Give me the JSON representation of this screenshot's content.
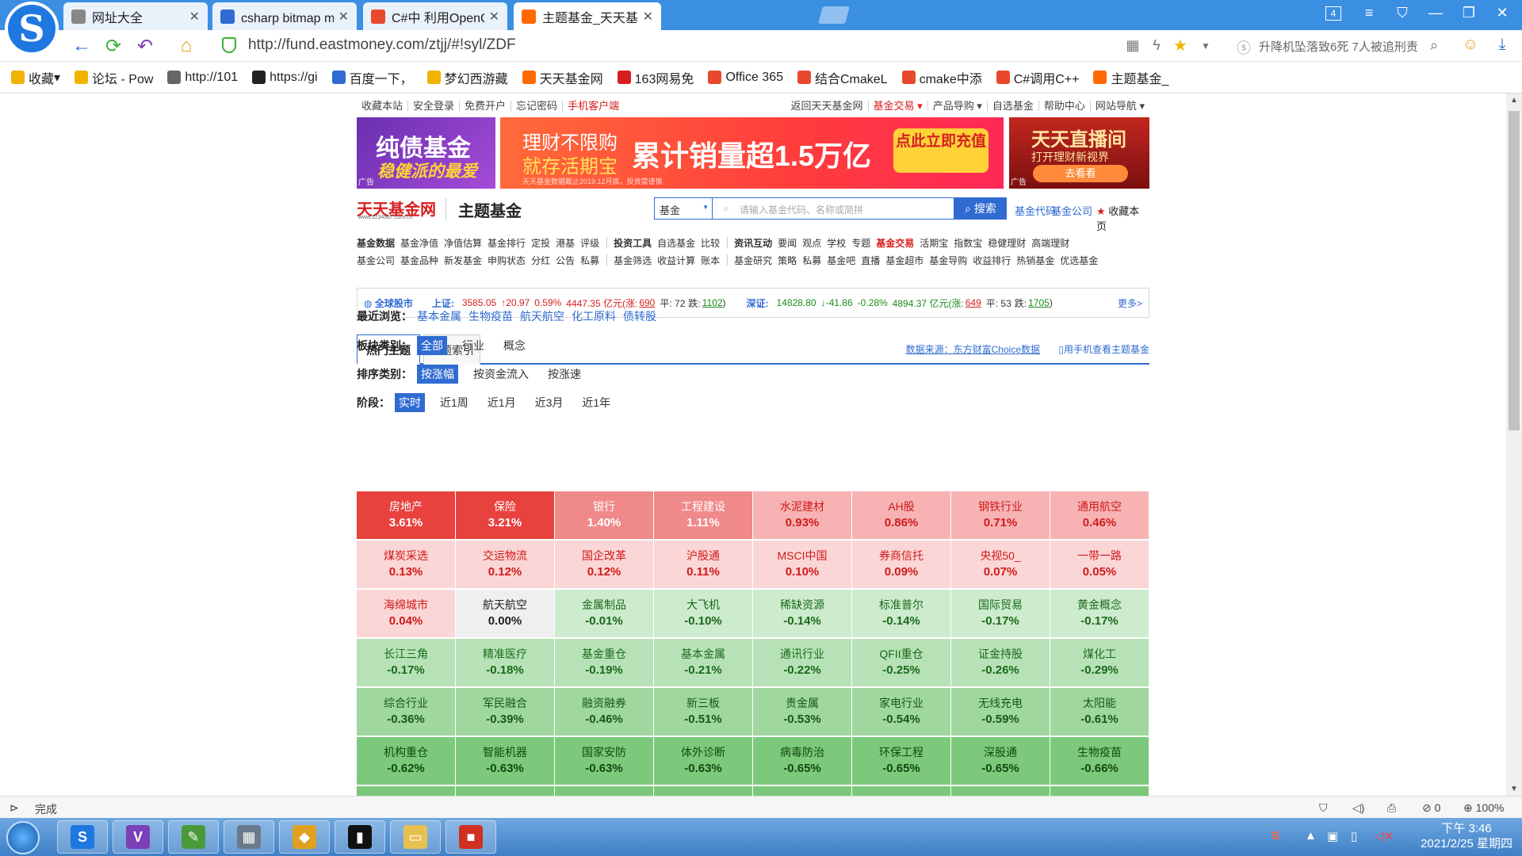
{
  "browser": {
    "tabs": [
      {
        "title": "网址大全",
        "icon_color": "#888888"
      },
      {
        "title": "csharp bitmap mat_百",
        "icon_color": "#2f6bd1"
      },
      {
        "title": "C#中 利用OpenCvShar",
        "icon_color": "#e8492d"
      },
      {
        "title": "主题基金_天天基金网",
        "icon_color": "#ff6a00"
      }
    ],
    "tab_count": "4",
    "url": "http://fund.eastmoney.com/ztjj/#!syl/ZDF",
    "news_ticker": "升降机坠落致6死 7人被追刑责",
    "bookmarks": [
      {
        "label": "收藏",
        "icon": "star-icon",
        "color": "#f0b400"
      },
      {
        "label": "论坛 - Pow",
        "icon": "forum-icon",
        "color": "#f0b400"
      },
      {
        "label": "http://101",
        "icon": "page-icon",
        "color": "#666666"
      },
      {
        "label": "https://gi",
        "icon": "github-icon",
        "color": "#222222"
      },
      {
        "label": "百度一下，",
        "icon": "baidu-icon",
        "color": "#2f6bd1"
      },
      {
        "label": "梦幻西游藏",
        "icon": "game-icon",
        "color": "#f0b400"
      },
      {
        "label": "天天基金网",
        "icon": "fund-icon",
        "color": "#ff6a00"
      },
      {
        "label": "163网易免",
        "icon": "netease-icon",
        "color": "#d71e1e"
      },
      {
        "label": "Office 365",
        "icon": "office-icon",
        "color": "#e8492d"
      },
      {
        "label": "结合CmakeL",
        "icon": "csdn-icon",
        "color": "#e8492d"
      },
      {
        "label": "cmake中添",
        "icon": "csdn-icon",
        "color": "#e8492d"
      },
      {
        "label": "C#调用C++",
        "icon": "csdn-icon",
        "color": "#e8492d"
      },
      {
        "label": "主题基金_",
        "icon": "fund-icon",
        "color": "#ff6a00"
      }
    ],
    "status": "完成",
    "zoom": "100%",
    "blocked_count": "0"
  },
  "site": {
    "topnav_left": [
      "收藏本站",
      "安全登录",
      "免费开户",
      "忘记密码",
      "手机客户端"
    ],
    "topnav_right": [
      "返回天天基金网",
      "基金交易 ▾",
      "产品导购 ▾",
      "自选基金",
      "帮助中心",
      "网站导航 ▾"
    ],
    "banners": {
      "b1_line1": "纯债基金",
      "b1_line2": "稳健派的最爱",
      "b2_line1": "理财不限购",
      "b2_line2": "就存活期宝",
      "b2_headline": "累计销量超1.5万亿",
      "b2_cta": "点此立即充值",
      "b2_small": "天天基金数据截止2019.12月底，投资需谨慎",
      "b3_title": "天天直播间",
      "b3_sub": "打开理财新视界",
      "b3_btn": "去看看",
      "ad_label": "广告"
    },
    "logo": "天天基金网",
    "logo_url": "www.1234567.com.cn",
    "section_title": "主题基金",
    "search": {
      "select": "基金",
      "placeholder": "请输入基金代码、名称或简拼",
      "button": "搜索"
    },
    "logo_links": [
      "基金代码",
      "基金公司"
    ],
    "fav_page": "收藏本页",
    "nav_row1": [
      {
        "t": "基金数据",
        "s": "hd"
      },
      {
        "t": "基金净值"
      },
      {
        "t": "净值估算"
      },
      {
        "t": "基金排行"
      },
      {
        "t": "定投"
      },
      {
        "t": "港基"
      },
      {
        "t": "评级"
      },
      {
        "t": "|",
        "s": "sep"
      },
      {
        "t": "投资工具",
        "s": "hd"
      },
      {
        "t": "自选基金"
      },
      {
        "t": "比较"
      },
      {
        "t": "|",
        "s": "sep"
      },
      {
        "t": "资讯互动",
        "s": "hd"
      },
      {
        "t": "要闻"
      },
      {
        "t": "观点"
      },
      {
        "t": "学校"
      },
      {
        "t": "专题"
      },
      {
        "t": "基金交易",
        "s": "hd-red"
      },
      {
        "t": "活期宝"
      },
      {
        "t": "指数宝"
      },
      {
        "t": "稳健理财"
      },
      {
        "t": "高端理财"
      }
    ],
    "nav_row2": [
      {
        "t": "基金公司"
      },
      {
        "t": "基金品种"
      },
      {
        "t": "新发基金"
      },
      {
        "t": "申购状态"
      },
      {
        "t": "分红"
      },
      {
        "t": "公告"
      },
      {
        "t": "私募"
      },
      {
        "t": "|",
        "s": "sep"
      },
      {
        "t": "基金筛选"
      },
      {
        "t": "收益计算"
      },
      {
        "t": "账本"
      },
      {
        "t": "|",
        "s": "sep"
      },
      {
        "t": "基金研究"
      },
      {
        "t": "策略"
      },
      {
        "t": "私募"
      },
      {
        "t": "基金吧"
      },
      {
        "t": "直播"
      },
      {
        "t": "基金超市"
      },
      {
        "t": "基金导购"
      },
      {
        "t": "收益排行"
      },
      {
        "t": "热销基金"
      },
      {
        "t": "优选基金"
      }
    ],
    "market": {
      "global": "全球股市",
      "sh_label": "上证:",
      "sh_value": "3585.05",
      "sh_change": "↑20.97",
      "sh_pct": "0.59%",
      "sh_amount": "4447.35 亿元(涨:",
      "sh_up": "690",
      "sh_flat": "平: 72",
      "sh_down_label": "跌:",
      "sh_down": "1102",
      "sz_label": "深证:",
      "sz_value": "14828.80",
      "sz_change": "↓-41.86",
      "sz_pct": "-0.28%",
      "sz_amount": "4894.37 亿元(涨:",
      "sz_up": "649",
      "sz_flat": "平: 53",
      "sz_down_label": "跌:",
      "sz_down": "1705",
      "close_paren": ")",
      "more": "更多>"
    },
    "tabs": [
      "热门主题",
      "主题索引"
    ],
    "source": "数据来源：东方财富Choice数据",
    "mobile_view": "用手机查看主题基金",
    "recent_label": "最近浏览：",
    "recent": [
      "基本金属",
      "生物疫苗",
      "航天航空",
      "化工原料",
      "债转股"
    ],
    "sector_label": "板块类别：",
    "sector_opts": [
      "全部",
      "行业",
      "概念"
    ],
    "sort_label": "排序类别：",
    "sort_opts": [
      "按涨幅",
      "按资金流入",
      "按涨速"
    ],
    "period_label": "阶段：",
    "period_opts": [
      "实时",
      "近1周",
      "近1月",
      "近3月",
      "近1年"
    ]
  },
  "heatmap": [
    {
      "name": "房地产",
      "pct": "3.61%",
      "bg": "#e8423f",
      "fg": "#ffffff"
    },
    {
      "name": "保险",
      "pct": "3.21%",
      "bg": "#e8423f",
      "fg": "#ffffff"
    },
    {
      "name": "银行",
      "pct": "1.40%",
      "bg": "#f0898a",
      "fg": "#ffffff"
    },
    {
      "name": "工程建设",
      "pct": "1.11%",
      "bg": "#f0898a",
      "fg": "#ffffff"
    },
    {
      "name": "水泥建材",
      "pct": "0.93%",
      "bg": "#f7b3b4",
      "fg": "#d01a1a"
    },
    {
      "name": "AH股",
      "pct": "0.86%",
      "bg": "#f7b3b4",
      "fg": "#d01a1a"
    },
    {
      "name": "钢铁行业",
      "pct": "0.71%",
      "bg": "#f7b3b4",
      "fg": "#d01a1a"
    },
    {
      "name": "通用航空",
      "pct": "0.46%",
      "bg": "#f7b3b4",
      "fg": "#d01a1a"
    },
    {
      "name": "煤炭采选",
      "pct": "0.13%",
      "bg": "#fbd6d6",
      "fg": "#d01a1a"
    },
    {
      "name": "交运物流",
      "pct": "0.12%",
      "bg": "#fbd6d6",
      "fg": "#d01a1a"
    },
    {
      "name": "国企改革",
      "pct": "0.12%",
      "bg": "#fbd6d6",
      "fg": "#d01a1a"
    },
    {
      "name": "沪股通",
      "pct": "0.11%",
      "bg": "#fbd6d6",
      "fg": "#d01a1a"
    },
    {
      "name": "MSCI中国",
      "pct": "0.10%",
      "bg": "#fbd6d6",
      "fg": "#d01a1a"
    },
    {
      "name": "券商信托",
      "pct": "0.09%",
      "bg": "#fbd6d6",
      "fg": "#d01a1a"
    },
    {
      "name": "央视50_",
      "pct": "0.07%",
      "bg": "#fbd6d6",
      "fg": "#d01a1a"
    },
    {
      "name": "一带一路",
      "pct": "0.05%",
      "bg": "#fbd6d6",
      "fg": "#d01a1a"
    },
    {
      "name": "海绵城市",
      "pct": "0.04%",
      "bg": "#fbd6d6",
      "fg": "#d01a1a"
    },
    {
      "name": "航天航空",
      "pct": "0.00%",
      "bg": "#efefef",
      "fg": "#222222"
    },
    {
      "name": "金属制品",
      "pct": "-0.01%",
      "bg": "#cdebcd",
      "fg": "#1a6a1a"
    },
    {
      "name": "大飞机",
      "pct": "-0.10%",
      "bg": "#cdebcd",
      "fg": "#1a6a1a"
    },
    {
      "name": "稀缺资源",
      "pct": "-0.14%",
      "bg": "#cdebcd",
      "fg": "#1a6a1a"
    },
    {
      "name": "标准普尔",
      "pct": "-0.14%",
      "bg": "#cdebcd",
      "fg": "#1a6a1a"
    },
    {
      "name": "国际贸易",
      "pct": "-0.17%",
      "bg": "#cdebcd",
      "fg": "#1a6a1a"
    },
    {
      "name": "黄金概念",
      "pct": "-0.17%",
      "bg": "#cdebcd",
      "fg": "#1a6a1a"
    },
    {
      "name": "长江三角",
      "pct": "-0.17%",
      "bg": "#b7e2b7",
      "fg": "#1a6a1a"
    },
    {
      "name": "精准医疗",
      "pct": "-0.18%",
      "bg": "#b7e2b7",
      "fg": "#1a6a1a"
    },
    {
      "name": "基金重仓",
      "pct": "-0.19%",
      "bg": "#b7e2b7",
      "fg": "#1a6a1a"
    },
    {
      "name": "基本金属",
      "pct": "-0.21%",
      "bg": "#b7e2b7",
      "fg": "#1a6a1a"
    },
    {
      "name": "通讯行业",
      "pct": "-0.22%",
      "bg": "#b7e2b7",
      "fg": "#1a6a1a"
    },
    {
      "name": "QFII重仓",
      "pct": "-0.25%",
      "bg": "#b7e2b7",
      "fg": "#1a6a1a"
    },
    {
      "name": "证金持股",
      "pct": "-0.26%",
      "bg": "#b7e2b7",
      "fg": "#1a6a1a"
    },
    {
      "name": "煤化工",
      "pct": "-0.29%",
      "bg": "#b7e2b7",
      "fg": "#1a6a1a"
    },
    {
      "name": "综合行业",
      "pct": "-0.36%",
      "bg": "#9fd79f",
      "fg": "#155a15"
    },
    {
      "name": "军民融合",
      "pct": "-0.39%",
      "bg": "#9fd79f",
      "fg": "#155a15"
    },
    {
      "name": "融资融券",
      "pct": "-0.46%",
      "bg": "#9fd79f",
      "fg": "#155a15"
    },
    {
      "name": "新三板",
      "pct": "-0.51%",
      "bg": "#9fd79f",
      "fg": "#155a15"
    },
    {
      "name": "贵金属",
      "pct": "-0.53%",
      "bg": "#9fd79f",
      "fg": "#155a15"
    },
    {
      "name": "家电行业",
      "pct": "-0.54%",
      "bg": "#9fd79f",
      "fg": "#155a15"
    },
    {
      "name": "无线充电",
      "pct": "-0.59%",
      "bg": "#9fd79f",
      "fg": "#155a15"
    },
    {
      "name": "太阳能",
      "pct": "-0.61%",
      "bg": "#9fd79f",
      "fg": "#155a15"
    },
    {
      "name": "机构重仓",
      "pct": "-0.62%",
      "bg": "#7cc97c",
      "fg": "#104a10"
    },
    {
      "name": "智能机器",
      "pct": "-0.63%",
      "bg": "#7cc97c",
      "fg": "#104a10"
    },
    {
      "name": "国家安防",
      "pct": "-0.63%",
      "bg": "#7cc97c",
      "fg": "#104a10"
    },
    {
      "name": "体外诊断",
      "pct": "-0.63%",
      "bg": "#7cc97c",
      "fg": "#104a10"
    },
    {
      "name": "病毒防治",
      "pct": "-0.65%",
      "bg": "#7cc97c",
      "fg": "#104a10"
    },
    {
      "name": "环保工程",
      "pct": "-0.65%",
      "bg": "#7cc97c",
      "fg": "#104a10"
    },
    {
      "name": "深股通",
      "pct": "-0.65%",
      "bg": "#7cc97c",
      "fg": "#104a10"
    },
    {
      "name": "生物疫苗",
      "pct": "-0.66%",
      "bg": "#7cc97c",
      "fg": "#104a10"
    }
  ],
  "taskbar": {
    "apps": [
      {
        "name": "sogou-browser-app",
        "glyph": "S",
        "color": "#1e78e0"
      },
      {
        "name": "visual-studio-app",
        "glyph": "V",
        "color": "#7b3fb8"
      },
      {
        "name": "paint-app",
        "glyph": "✎",
        "color": "#4a9a3a"
      },
      {
        "name": "calculator-app",
        "glyph": "▦",
        "color": "#6a7a8a"
      },
      {
        "name": "git-app",
        "glyph": "◆",
        "color": "#e0a020"
      },
      {
        "name": "console-app",
        "glyph": "▮",
        "color": "#111111"
      },
      {
        "name": "explorer-app",
        "glyph": "▭",
        "color": "#e8c050"
      },
      {
        "name": "windows-app",
        "glyph": "■",
        "color": "#d03020"
      }
    ],
    "time": "下午 3:46",
    "date": "2021/2/25 星期四"
  }
}
